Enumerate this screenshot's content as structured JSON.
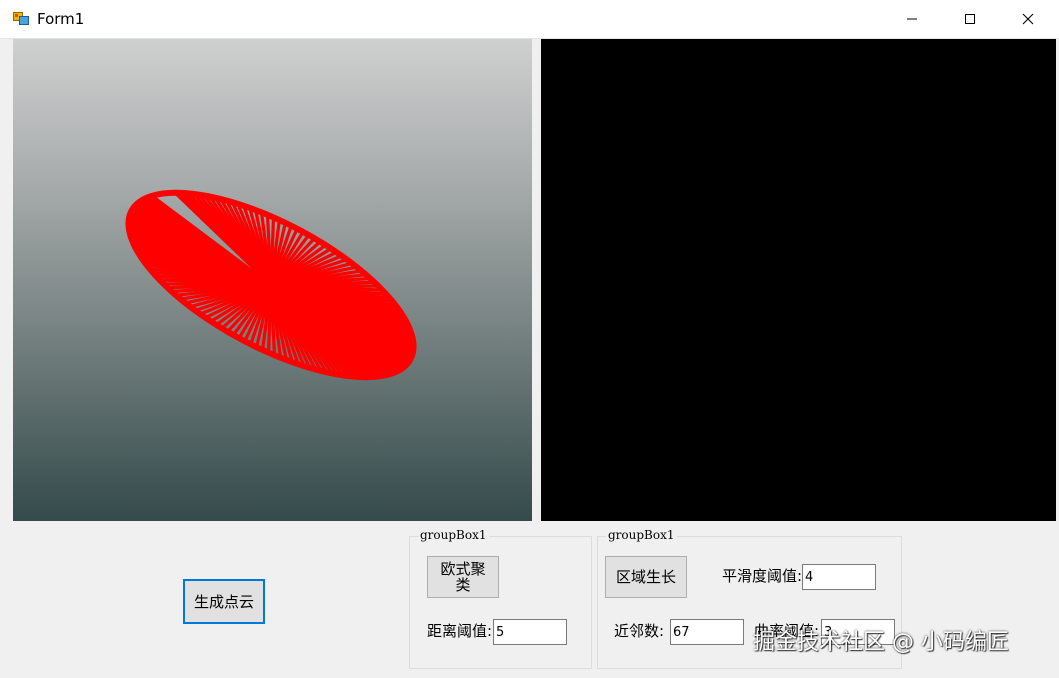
{
  "window": {
    "title": "Form1",
    "controls": {
      "minimize": "minimize-icon",
      "maximize": "maximize-icon",
      "close": "close-icon"
    }
  },
  "viewports": {
    "left": {
      "background_top": "#cfd0d0",
      "background_bottom": "#344a4b",
      "point_color": "#ff0000"
    },
    "right": {
      "background": "#000000"
    }
  },
  "buttons": {
    "generate": "生成点云",
    "euclidean": "欧式聚类",
    "region_growing": "区域生长"
  },
  "group1": {
    "title": "groupBox1",
    "distance_label": "距离阈值:",
    "distance_value": "5"
  },
  "group2": {
    "title": "groupBox1",
    "smooth_label": "平滑度阈值:",
    "smooth_value": "4",
    "neighbors_label": "近邻数:",
    "neighbors_value": "67",
    "curvature_label": "曲率阈值:",
    "curvature_value": "3"
  },
  "watermark": "掘金技术社区 @ 小码编匠",
  "colors": {
    "accent": "#0078d7",
    "button_face": "#e1e1e1"
  }
}
